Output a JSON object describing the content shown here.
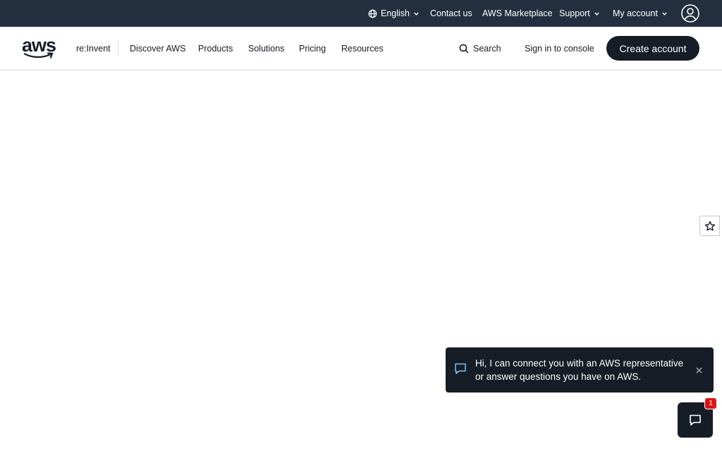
{
  "topbar": {
    "language": "English",
    "contact": "Contact us",
    "marketplace": "AWS Marketplace",
    "support": "Support",
    "account": "My account"
  },
  "navbar": {
    "logo": "aws",
    "reinvent": "re:Invent",
    "discover": "Discover AWS",
    "products": "Products",
    "solutions": "Solutions",
    "pricing": "Pricing",
    "resources": "Resources",
    "search": "Search",
    "sign_in": "Sign in to console",
    "create_account": "Create account"
  },
  "chat": {
    "message": "Hi, I can connect you with an AWS representative or answer questions you have on AWS.",
    "badge_count": "1"
  },
  "colors": {
    "topbar_bg": "#232f3e",
    "dark": "#161d26",
    "badge": "#d91515"
  }
}
